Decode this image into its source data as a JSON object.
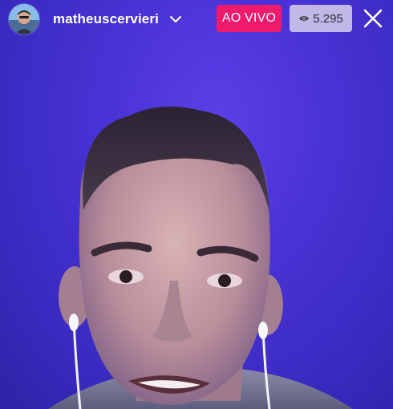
{
  "stream": {
    "username": "matheuscervieri",
    "live_label": "AO VIVO",
    "viewer_count": "5.295"
  },
  "icons": {
    "dropdown": "chevron-down-icon",
    "viewers": "eye-icon",
    "close": "close-icon"
  },
  "colors": {
    "live_badge": "#ee1b6c",
    "background": "#4a33d6"
  }
}
